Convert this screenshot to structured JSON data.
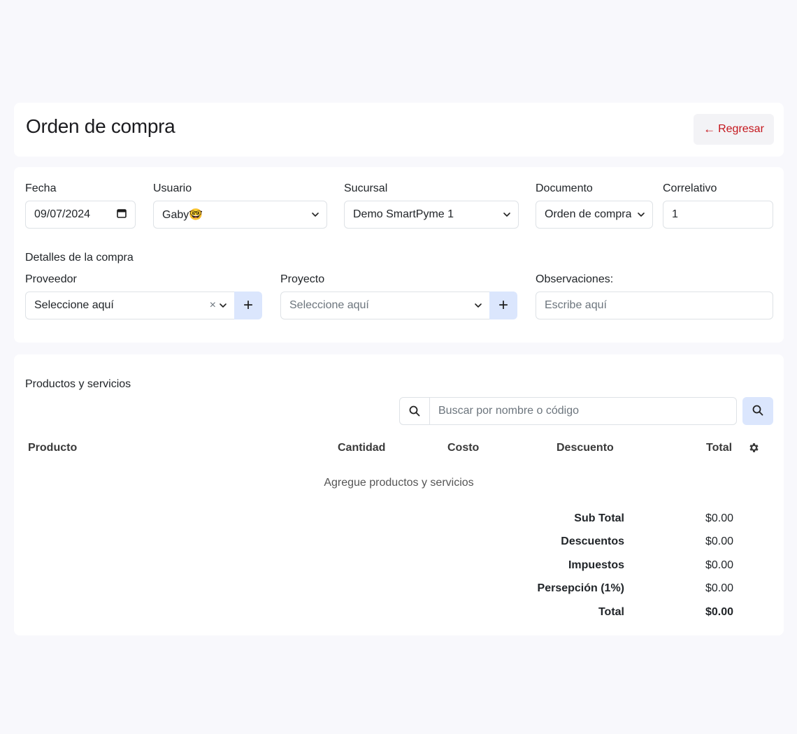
{
  "header": {
    "title": "Orden de compra",
    "back_label": "Regresar",
    "back_arrow": "←"
  },
  "form": {
    "fecha": {
      "label": "Fecha",
      "value": "09/07/2024"
    },
    "usuario": {
      "label": "Usuario",
      "value": "Gaby",
      "emoji": "🤓"
    },
    "sucursal": {
      "label": "Sucursal",
      "value": "Demo SmartPyme 1"
    },
    "documento": {
      "label": "Documento",
      "value": "Orden de compra"
    },
    "correlativo": {
      "label": "Correlativo",
      "value": "1"
    },
    "section_title": "Detalles de la compra",
    "proveedor": {
      "label": "Proveedor",
      "value": "Seleccione aquí",
      "clear": "×"
    },
    "proyecto": {
      "label": "Proyecto",
      "placeholder": "Seleccione aquí"
    },
    "observaciones": {
      "label": "Observaciones:",
      "placeholder": "Escribe aquí"
    },
    "add_label": "+"
  },
  "products": {
    "section_title": "Productos y servicios",
    "search_placeholder": "Buscar por nombre o código",
    "columns": {
      "producto": "Producto",
      "cantidad": "Cantidad",
      "costo": "Costo",
      "descuento": "Descuento",
      "total": "Total"
    },
    "empty_message": "Agregue productos y servicios",
    "summary": [
      {
        "label": "Sub Total",
        "value": "$0.00"
      },
      {
        "label": "Descuentos",
        "value": "$0.00"
      },
      {
        "label": "Impuestos",
        "value": "$0.00"
      },
      {
        "label": "Persepción (1%)",
        "value": "$0.00"
      },
      {
        "label": "Total",
        "value": "$0.00"
      }
    ]
  },
  "colors": {
    "accent_red": "#c4161c",
    "button_blue_light": "#dbe6fd",
    "page_bg": "#f8f8fc"
  },
  "icons": [
    "arrow-left-icon",
    "calendar-icon",
    "chevron-down-icon",
    "clear-icon",
    "plus-icon",
    "search-icon",
    "gear-icon"
  ]
}
